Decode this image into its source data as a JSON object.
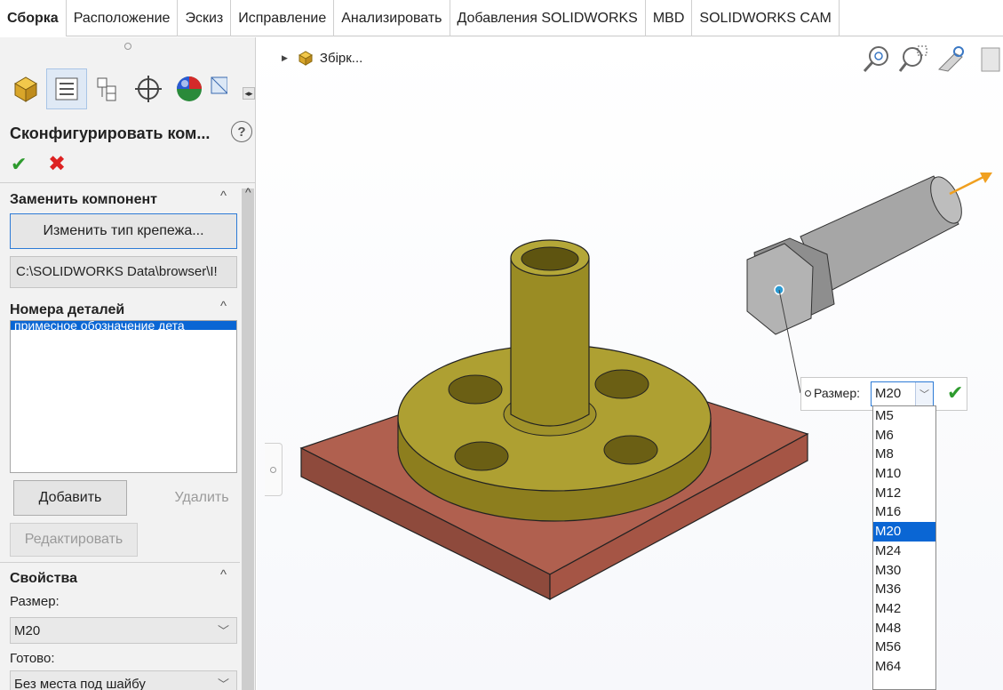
{
  "ribbon": {
    "tabs": [
      {
        "label": "Сборка",
        "active": true
      },
      {
        "label": "Расположение",
        "active": false
      },
      {
        "label": "Эскиз",
        "active": false
      },
      {
        "label": "Исправление",
        "active": false
      },
      {
        "label": "Анализировать",
        "active": false
      },
      {
        "label": "Добавления SOLIDWORKS",
        "active": false
      },
      {
        "label": "MBD",
        "active": false
      },
      {
        "label": "SOLIDWORKS CAM",
        "active": false
      }
    ]
  },
  "panel": {
    "toolbar_icons": [
      "feature-manager-icon",
      "property-manager-icon",
      "configuration-manager-icon",
      "dimxpert-icon",
      "display-manager-icon",
      "cam-icon"
    ],
    "title": "Сконфигурировать ком...",
    "replace_group": {
      "heading": "Заменить компонент",
      "change_fastener_button": "Изменить тип крепежа...",
      "path": "C:\\SOLIDWORKS Data\\browser\\I!"
    },
    "part_numbers_group": {
      "heading": "Номера деталей",
      "selected_item": "примесное обозначение дета",
      "add_button": "Добавить",
      "delete_button": "Удалить",
      "edit_button": "Редактировать"
    },
    "properties_group": {
      "heading": "Свойства",
      "size_label": "Размер:",
      "size_value": "M20",
      "ready_label": "Готово:",
      "ready_value": "Без места под шайбу"
    }
  },
  "viewport": {
    "tree_node": "Збірк...",
    "hud_icons": [
      "zoom-to-fit-icon",
      "zoom-to-area-icon",
      "previous-view-icon",
      "section-view-icon"
    ],
    "size_callout": {
      "label": "Размер:",
      "value": "M20",
      "options": [
        "M5",
        "M6",
        "M8",
        "M10",
        "M12",
        "M16",
        "M20",
        "M24",
        "M30",
        "M36",
        "M42",
        "M48",
        "M56",
        "M64"
      ],
      "selected": "M20"
    }
  },
  "colors": {
    "plate": "#a8584a",
    "flange": "#a89a2c",
    "bolt": "#9a9a9a",
    "selection": "#0a66d4",
    "ok_green": "#2e9b2e",
    "cancel_red": "#dd2222",
    "arrow": "#f0a020"
  }
}
